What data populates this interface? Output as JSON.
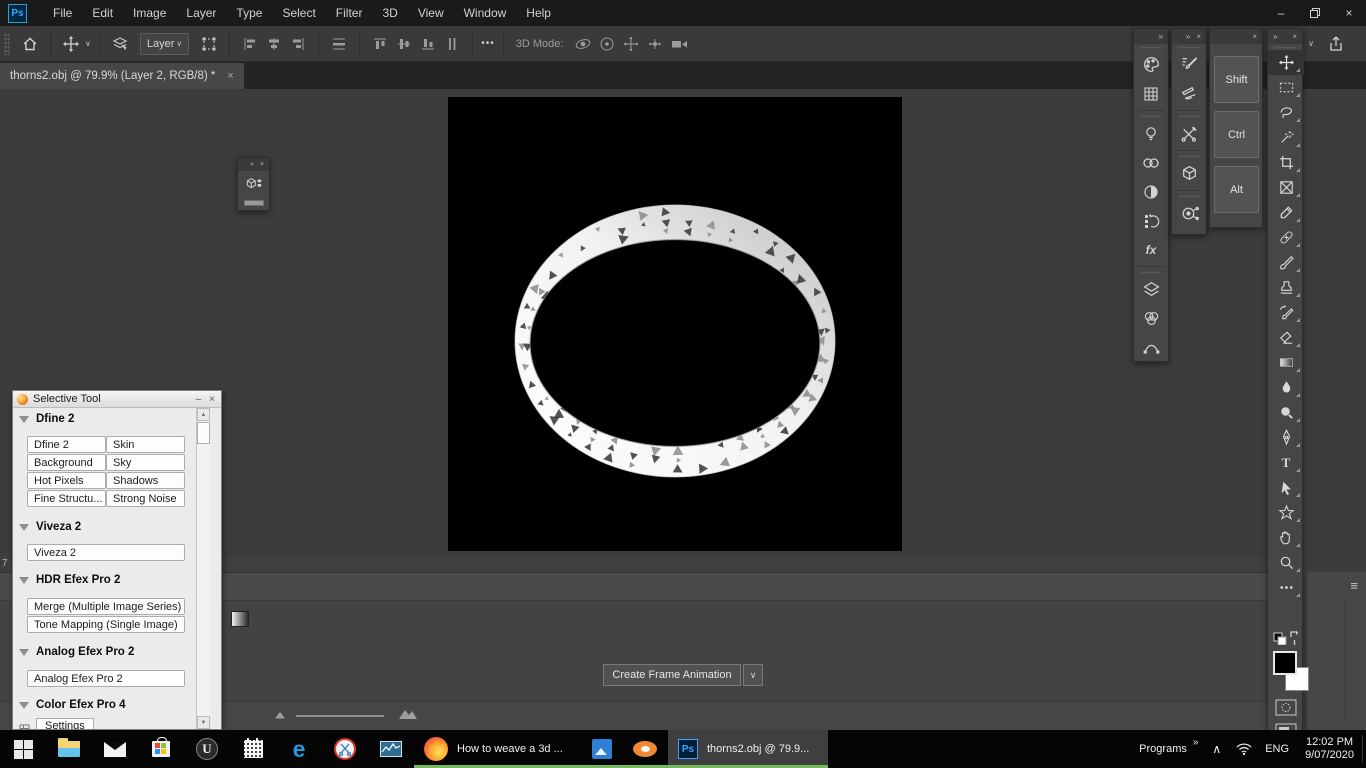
{
  "glyphs": {
    "close": "×",
    "minimize": "–",
    "chevron_down": "∨",
    "expand": "»",
    "scroll_up": "▲",
    "scroll_down": "▼",
    "chevron_right": "›",
    "chevron_left": "‹",
    "caret_up": "∧",
    "menu": "≡",
    "ellipsis": "•••",
    "fx": "fx",
    "type_tool": "T",
    "edge": "e",
    "unreal": "U"
  },
  "titlebar": {
    "logo": "Ps",
    "menus": [
      "File",
      "Edit",
      "Image",
      "Layer",
      "Type",
      "Select",
      "Filter",
      "3D",
      "View",
      "Window",
      "Help"
    ]
  },
  "options_bar": {
    "layer_select": "Layer",
    "mode_label": "3D Mode:"
  },
  "tab": {
    "title": "thorns2.obj @ 79.9% (Layer 2, RGB/8) *"
  },
  "modifier_keys": [
    "Shift",
    "Ctrl",
    "Alt"
  ],
  "selective_tool": {
    "title": "Selective Tool",
    "sections": [
      {
        "header": "Dfine 2",
        "buttons": [
          "Dfine 2",
          "Skin",
          "Background",
          "Sky",
          "Hot Pixels",
          "Shadows",
          "Fine Structu...",
          "Strong Noise"
        ]
      },
      {
        "header": "Viveza 2",
        "buttons": [
          "Viveza 2"
        ]
      },
      {
        "header": "HDR Efex Pro 2",
        "buttons": [
          "Merge (Multiple Image Series)",
          "Tone Mapping (Single Image)"
        ]
      },
      {
        "header": "Analog Efex Pro 2",
        "buttons": [
          "Analog Efex Pro 2"
        ]
      },
      {
        "header": "Color Efex Pro 4",
        "buttons": []
      }
    ],
    "footer_partial": "Settings"
  },
  "timeline": {
    "create_frame_button": "Create Frame Animation"
  },
  "status_bar": {
    "partial_text": "7"
  },
  "taskbar": {
    "buttons": [
      {
        "label": "How to weave a 3d ..."
      },
      {
        "label": "thorns2.obj @ 79.9..."
      }
    ],
    "tray": {
      "programs": "Programs",
      "language": "ENG",
      "time": "12:02 PM",
      "date": "9/07/2020"
    }
  },
  "colors": {
    "accent_green": "#76b85e",
    "ps_blue": "#31a8ff"
  }
}
